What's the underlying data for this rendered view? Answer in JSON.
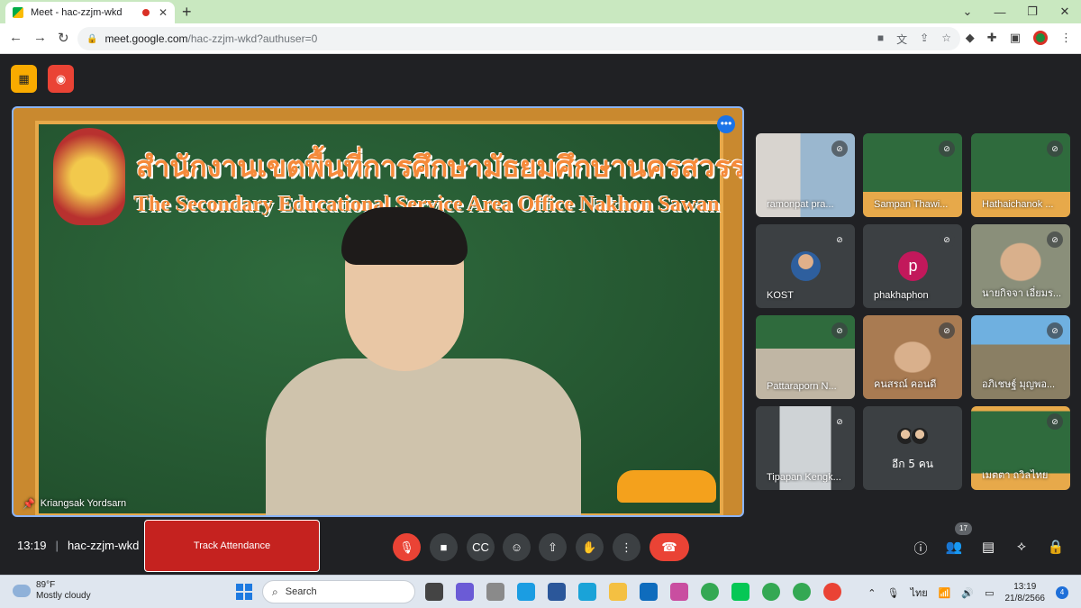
{
  "browser": {
    "tab_title": "Meet - hac-zzjm-wkd",
    "url_host": "meet.google.com",
    "url_path": "/hac-zzjm-wkd?authuser=0"
  },
  "main_speaker": {
    "name": "Kriangsak Yordsarn",
    "banner_thai": "สำนักงานเขตพื้นที่การศึกษามัธยมศึกษานครสวรรค์",
    "banner_english": "The Secondary Educational Service Area Office Nakhon Sawan"
  },
  "participants": [
    {
      "name": "ramonpat pra..."
    },
    {
      "name": "Sampan Thawi..."
    },
    {
      "name": "Hathaichanok ..."
    },
    {
      "name": "KOST"
    },
    {
      "name": "phakhaphon",
      "initial": "p"
    },
    {
      "name": "นายกิจจา เอี่ยมร..."
    },
    {
      "name": "Pattaraporn N..."
    },
    {
      "name": "คนสรณ์ คอนดี"
    },
    {
      "name": "อภิเชษฐ์ มุญพอ..."
    },
    {
      "name": "Tipapan Kengk..."
    },
    {
      "name": "อีก 5 คน"
    },
    {
      "name": "เมตตา ถวิลไทย"
    }
  ],
  "meeting": {
    "time": "13:19",
    "code": "hac-zzjm-wkd",
    "track_attendance": "Track Attendance",
    "participant_count": "17"
  },
  "taskbar": {
    "temperature": "89°F",
    "weather": "Mostly cloudy",
    "search_placeholder": "Search",
    "language": "ไทย",
    "clock_time": "13:19",
    "clock_date": "21/8/2566",
    "notifications": "4"
  }
}
